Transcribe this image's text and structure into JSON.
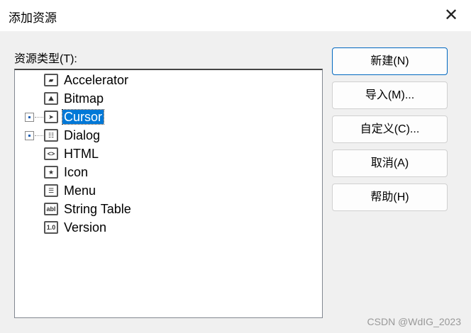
{
  "window": {
    "title": "添加资源",
    "close_icon": "close-icon"
  },
  "tree_label": "资源类型(T):",
  "tree": [
    {
      "label": "Accelerator",
      "icon": "accelerator-icon",
      "expandable": false,
      "glyph": "▰"
    },
    {
      "label": "Bitmap",
      "icon": "bitmap-icon",
      "expandable": false,
      "glyph": "⛰"
    },
    {
      "label": "Cursor",
      "icon": "cursor-icon",
      "expandable": true,
      "selected": true,
      "glyph": "➤"
    },
    {
      "label": "Dialog",
      "icon": "dialog-icon",
      "expandable": true,
      "glyph": "☷"
    },
    {
      "label": "HTML",
      "icon": "html-icon",
      "expandable": false,
      "glyph": "<>"
    },
    {
      "label": "Icon",
      "icon": "icon-resource-icon",
      "expandable": false,
      "glyph": "★"
    },
    {
      "label": "Menu",
      "icon": "menu-icon",
      "expandable": false,
      "glyph": "☰"
    },
    {
      "label": "String Table",
      "icon": "string-table-icon",
      "expandable": false,
      "glyph": "abl"
    },
    {
      "label": "Version",
      "icon": "version-icon",
      "expandable": false,
      "glyph": "1.0"
    }
  ],
  "buttons": {
    "new": "新建(N)",
    "import": "导入(M)...",
    "custom": "自定义(C)...",
    "cancel": "取消(A)",
    "help": "帮助(H)"
  },
  "watermark": "CSDN @WdIG_2023"
}
